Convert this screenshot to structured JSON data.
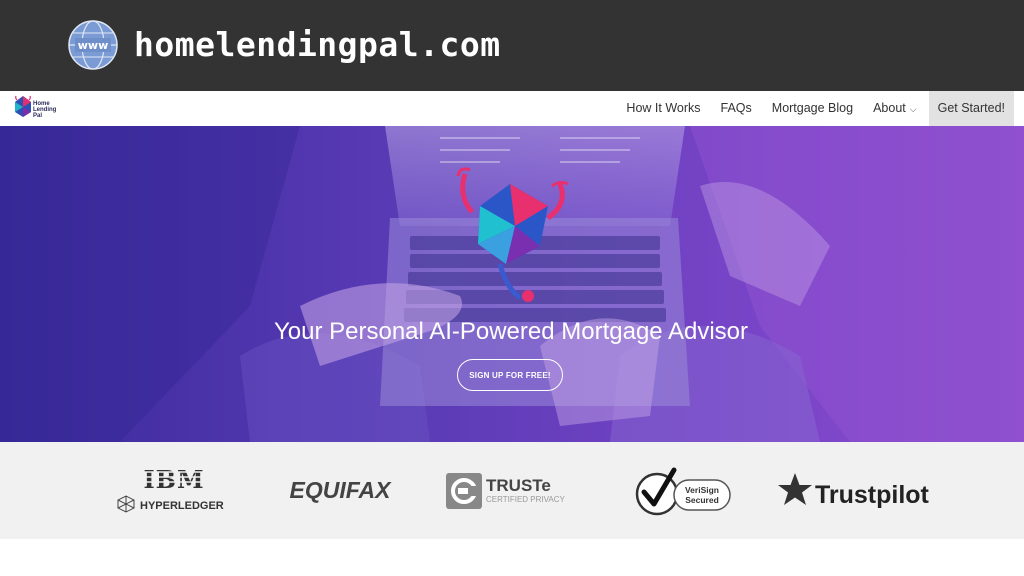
{
  "browser": {
    "url": "homelendingpal.com",
    "globe_label": "www"
  },
  "site": {
    "logo_text_line1": "Home",
    "logo_text_line2": "Lending",
    "logo_text_line3": "Pal",
    "nav": {
      "how_it_works": "How It Works",
      "faqs": "FAQs",
      "mortgage_blog": "Mortgage Blog",
      "about": "About",
      "get_started": "Get Started!"
    }
  },
  "hero": {
    "title": "Your Personal AI-Powered Mortgage Advisor",
    "cta": "SIGN UP FOR FREE!"
  },
  "partners": {
    "ibm": "IBM",
    "hyperledger": "HYPERLEDGER",
    "equifax": "EQUIFAX",
    "truste": "TRUSTe",
    "truste_sub": "CERTIFIED PRIVACY",
    "verisign_line1": "VeriSign",
    "verisign_line2": "Secured",
    "trustpilot": "Trustpilot"
  },
  "colors": {
    "banner": "#333333",
    "hero_left": "#3b2a9c",
    "hero_right": "#8a4ccc",
    "partners_bg": "#f1f1f1"
  }
}
